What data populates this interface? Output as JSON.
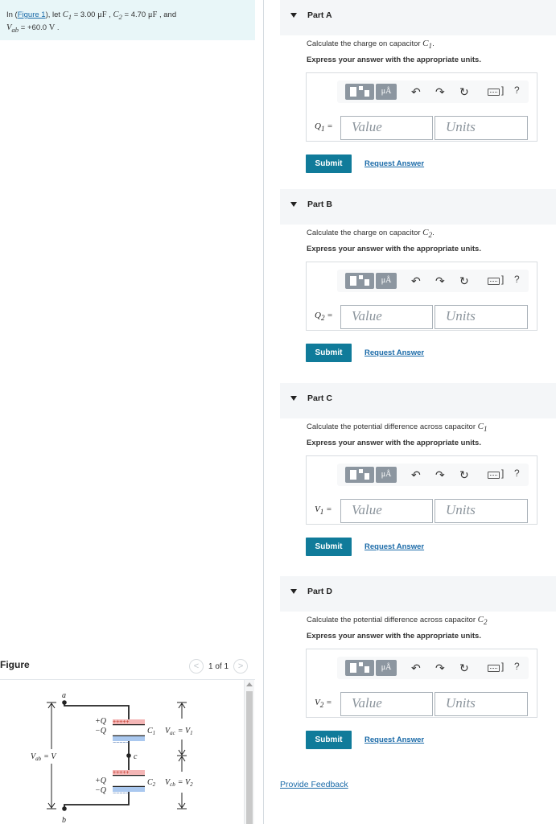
{
  "problem": {
    "lead": "In (",
    "figure_link": "Figure 1",
    "mid1": "), let ",
    "c1_sym": "C",
    "c1_sub": "1",
    "eq1": " = 3.00 ",
    "unit_uF": "μF",
    "comma": " , ",
    "c2_sym": "C",
    "c2_sub": "2",
    "eq2": " = 4.70 ",
    "tail": " , and",
    "v_sym": "V",
    "v_sub": "ab",
    "eq3": " = +60.0 ",
    "unit_V": "V",
    "period": " ."
  },
  "figure": {
    "title": "Figure",
    "page_indicator": "1 of 1",
    "prev_icon": "<",
    "next_icon": ">",
    "circuit": {
      "node_a": "a",
      "node_b": "b",
      "node_c": "c",
      "vab_label": "V",
      "vab_sub": "ab",
      "vab_eq": "= V",
      "plus_q": "+Q",
      "minus_q": "−Q",
      "plus_signs": "+++++",
      "minus_signs": "−−−−−",
      "c1": "C",
      "c1_sub": "1",
      "c2": "C",
      "c2_sub": "2",
      "vac": "V",
      "vac_sub": "ac",
      "vac_eq": "= V",
      "vac_eq_sub": "1",
      "vcb": "V",
      "vcb_sub": "cb",
      "vcb_eq": "= V",
      "vcb_eq_sub": "2"
    }
  },
  "toolbar": {
    "units_symbol": "μÅ",
    "undo_icon": "↶",
    "redo_icon": "↷",
    "reset_icon": "↻",
    "bracket": "]",
    "help": "?"
  },
  "parts": [
    {
      "title": "Part A",
      "question_prefix": "Calculate the charge on capacitor ",
      "q_sym": "C",
      "q_sub": "1",
      "question_suffix": ".",
      "instruction": "Express your answer with the appropriate units.",
      "var": "Q",
      "var_sub": "1",
      "var_eq": " =",
      "value_placeholder": "Value",
      "units_placeholder": "Units",
      "submit": "Submit",
      "request": "Request Answer"
    },
    {
      "title": "Part B",
      "question_prefix": "Calculate the charge on capacitor ",
      "q_sym": "C",
      "q_sub": "2",
      "question_suffix": ".",
      "instruction": "Express your answer with the appropriate units.",
      "var": "Q",
      "var_sub": "2",
      "var_eq": " =",
      "value_placeholder": "Value",
      "units_placeholder": "Units",
      "submit": "Submit",
      "request": "Request Answer"
    },
    {
      "title": "Part C",
      "question_prefix": "Calculate the potential difference across capacitor ",
      "q_sym": "C",
      "q_sub": "1",
      "question_suffix": "",
      "instruction": "Express your answer with the appropriate units.",
      "var": "V",
      "var_sub": "1",
      "var_eq": " =",
      "value_placeholder": "Value",
      "units_placeholder": "Units",
      "submit": "Submit",
      "request": "Request Answer"
    },
    {
      "title": "Part D",
      "question_prefix": "Calculate the potential difference across capacitor ",
      "q_sym": "C",
      "q_sub": "2",
      "question_suffix": "",
      "instruction": "Express your answer with the appropriate units.",
      "var": "V",
      "var_sub": "2",
      "var_eq": " =",
      "value_placeholder": "Value",
      "units_placeholder": "Units",
      "submit": "Submit",
      "request": "Request Answer"
    }
  ],
  "feedback": "Provide Feedback",
  "colors": {
    "accent": "#107b9a",
    "link": "#1a6aa8",
    "problem_bg": "#e8f6f8",
    "plus_band": "#f4b6b6",
    "minus_band": "#aac8ef"
  }
}
